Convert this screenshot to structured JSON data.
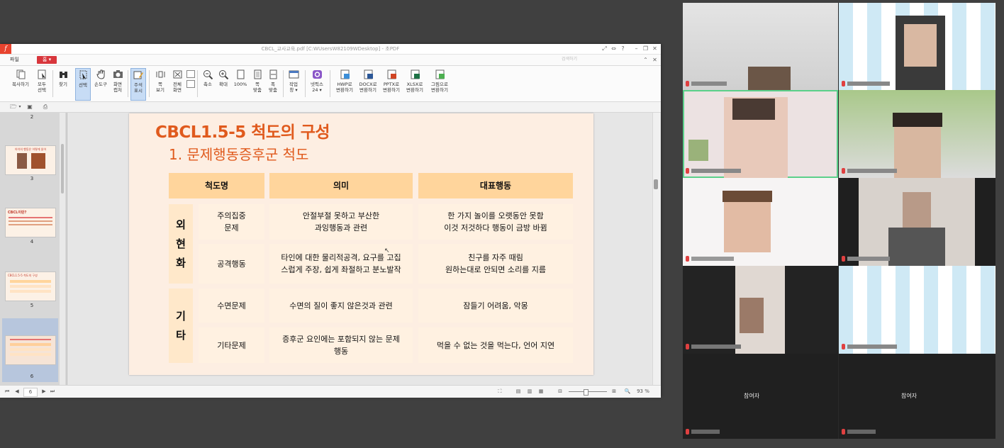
{
  "window": {
    "title": "CBCL_교사교육.pdf [C:WUsersW82109WDesktop] - 초PDF",
    "search_placeholder": "검색하기"
  },
  "menu": {
    "file": "파일",
    "home": "홈"
  },
  "ribbon": {
    "copy": "복사하기",
    "select_all_l1": "모두",
    "select_all_l2": "선택",
    "find": "찾기",
    "select": "선택",
    "hand": "손도구",
    "capture_l1": "화면",
    "capture_l2": "캡처",
    "annotation_l1": "주석",
    "annotation_l2": "표시",
    "page_view_l1": "쪽",
    "page_view_l2": "보기",
    "full_screen_l1": "전체",
    "full_screen_l2": "화면",
    "zoom_out": "축소",
    "zoom_in": "확대",
    "zoom_100": "100%",
    "fit_page_l1": "쪽",
    "fit_page_l2": "맞춤",
    "fit_width_l1": "폭",
    "fit_width_l2": "맞춤",
    "workspace_l1": "작업",
    "workspace_l2": "창",
    "netpix_l1": "넷픽스",
    "netpix_l2": "24",
    "to_hwp_l1": "HWP로",
    "to_hwp_l2": "변환하기",
    "to_docx_l1": "DOCX로",
    "to_docx_l2": "변환하기",
    "to_pptx_l1": "PPTX로",
    "to_pptx_l2": "변환하기",
    "to_xlsx_l1": "XLSX로",
    "to_xlsx_l2": "변환하기",
    "to_image_l1": "그림으로",
    "to_image_l2": "변환하기"
  },
  "thumbs": {
    "p2": "2",
    "p3": "3",
    "p4": "4",
    "p5": "5",
    "p6": "6",
    "p3_text": "아이의 행동은 어떻게 읽어",
    "p4_text": "CBCL이란?",
    "p5_text": "CBCL1.5-5 척도의 구성"
  },
  "slide": {
    "title": "CBCL1.5-5 척도의 구성",
    "subtitle": "1. 문제행동증후군 척도",
    "headers": {
      "scale": "척도명",
      "meaning": "의미",
      "behavior": "대표행동"
    },
    "group_external": "외\n현\n화",
    "group_other": "기\n타",
    "rows": [
      {
        "scale": "주의집중\n문제",
        "meaning": "안절부절 못하고 부산한\n과잉행동과 관련",
        "behavior": "한 가지 놀이를 오랫동안 못함\n이것 저것하다 행동이 금방 바뀜"
      },
      {
        "scale": "공격행동",
        "meaning": "타인에 대한 물리적공격, 요구를 고집\n스럽게 주장, 쉽게 좌절하고 분노발작",
        "behavior": "친구를 자주 때림\n원하는대로 안되면 소리를 지름"
      },
      {
        "scale": "수면문제",
        "meaning": "수면의 질이 좋지 않은것과 관련",
        "behavior": "잠들기 어려움, 악몽"
      },
      {
        "scale": "기타문제",
        "meaning": "증후군 요인에는 포함되지 않는 문제\n행동",
        "behavior": "먹을 수 없는 것을 먹는다, 언어 지연"
      }
    ]
  },
  "status": {
    "page": "6",
    "zoom": "93 %"
  },
  "gallery": {
    "tile9_name": "참여자",
    "tile10_name": "참여자"
  }
}
